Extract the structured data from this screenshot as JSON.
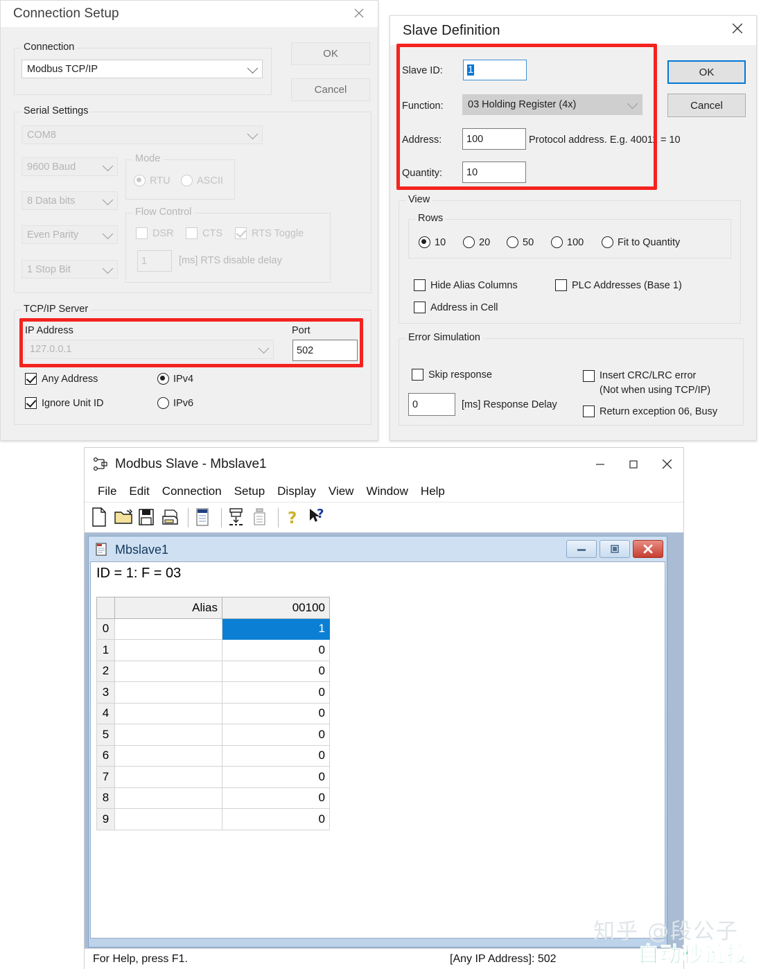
{
  "connection_setup": {
    "title": "Connection Setup",
    "close_icon": "close-icon",
    "ok_label": "OK",
    "cancel_label": "Cancel",
    "connection_group": {
      "legend": "Connection",
      "selected": "Modbus TCP/IP"
    },
    "serial_group": {
      "legend": "Serial Settings",
      "port": "COM8",
      "baud": "9600 Baud",
      "databits": "8 Data bits",
      "parity": "Even Parity",
      "stopbits": "1 Stop Bit",
      "mode": {
        "legend": "Mode",
        "options": [
          "RTU",
          "ASCII"
        ],
        "selected": "RTU"
      },
      "flow_control": {
        "legend": "Flow Control",
        "dsr_label": "DSR",
        "dsr_checked": false,
        "cts_label": "CTS",
        "cts_checked": false,
        "rts_toggle_label": "RTS Toggle",
        "rts_toggle_checked": true,
        "rts_delay_value": "1",
        "rts_delay_label": "[ms] RTS disable delay"
      }
    },
    "tcpip_group": {
      "legend": "TCP/IP Server",
      "ip_label": "IP Address",
      "ip_value": "127.0.0.1",
      "port_label": "Port",
      "port_value": "502",
      "any_address_label": "Any Address",
      "any_address_checked": true,
      "ignore_unit_id_label": "Ignore Unit ID",
      "ignore_unit_id_checked": true,
      "ipv4_label": "IPv4",
      "ipv6_label": "IPv6",
      "ip_version_selected": "IPv4"
    }
  },
  "slave_definition": {
    "title": "Slave Definition",
    "close_icon": "close-icon",
    "ok_label": "OK",
    "cancel_label": "Cancel",
    "slave_id_label": "Slave ID:",
    "slave_id_value": "1",
    "function_label": "Function:",
    "function_value": "03 Holding Register (4x)",
    "address_label": "Address:",
    "address_value": "100",
    "address_hint": "Protocol address. E.g. 40011 = 10",
    "quantity_label": "Quantity:",
    "quantity_value": "10",
    "view_group": {
      "legend": "View",
      "rows_legend": "Rows",
      "rows_options": [
        "10",
        "20",
        "50",
        "100",
        "Fit to Quantity"
      ],
      "rows_selected": "10",
      "hide_alias_label": "Hide Alias Columns",
      "hide_alias_checked": false,
      "plc_addresses_label": "PLC Addresses (Base 1)",
      "plc_addresses_checked": false,
      "address_in_cell_label": "Address in Cell",
      "address_in_cell_checked": false
    },
    "error_group": {
      "legend": "Error Simulation",
      "skip_response_label": "Skip response",
      "skip_response_checked": false,
      "response_delay_value": "0",
      "response_delay_label": "[ms] Response Delay",
      "insert_crc_label": "Insert CRC/LRC error\n(Not when using TCP/IP)",
      "insert_crc_checked": false,
      "return_exception_label": "Return exception 06, Busy",
      "return_exception_checked": false
    }
  },
  "main_window": {
    "title": "Modbus Slave - Mbslave1",
    "app_icon": "modbus-slave-icon",
    "minimize_icon": "minimize-icon",
    "maximize_icon": "maximize-icon",
    "close_icon": "close-icon",
    "menu": [
      "File",
      "Edit",
      "Connection",
      "Setup",
      "Display",
      "View",
      "Window",
      "Help"
    ],
    "toolbar": [
      "new-file-icon",
      "open-folder-icon",
      "save-disk-icon",
      "print-icon",
      "display-icon",
      "download-icon",
      "upload-icon",
      "help-icon",
      "context-help-icon"
    ],
    "child_window": {
      "icon": "document-icon",
      "title": "Mbslave1",
      "minimize_icon": "minimize-icon",
      "restore-icon": "restore-icon",
      "close_icon": "close-icon",
      "id_line": "ID = 1: F = 03",
      "columns": [
        "",
        "Alias",
        "00100"
      ],
      "rows": [
        {
          "index": "0",
          "alias": "",
          "value": "1",
          "selected": true
        },
        {
          "index": "1",
          "alias": "",
          "value": "0",
          "selected": false
        },
        {
          "index": "2",
          "alias": "",
          "value": "0",
          "selected": false
        },
        {
          "index": "3",
          "alias": "",
          "value": "0",
          "selected": false
        },
        {
          "index": "4",
          "alias": "",
          "value": "0",
          "selected": false
        },
        {
          "index": "5",
          "alias": "",
          "value": "0",
          "selected": false
        },
        {
          "index": "6",
          "alias": "",
          "value": "0",
          "selected": false
        },
        {
          "index": "7",
          "alias": "",
          "value": "0",
          "selected": false
        },
        {
          "index": "8",
          "alias": "",
          "value": "0",
          "selected": false
        },
        {
          "index": "9",
          "alias": "",
          "value": "0",
          "selected": false
        }
      ]
    },
    "status_left": "For Help, press F1.",
    "status_right": "[Any IP Address]: 502"
  },
  "watermark": {
    "line1": "知乎 @段公子",
    "line2": "自动秒链接"
  },
  "colors": {
    "annotation_red": "#f4231f",
    "selection_blue": "#0b7fd4",
    "accent_blue": "#0078d7"
  }
}
